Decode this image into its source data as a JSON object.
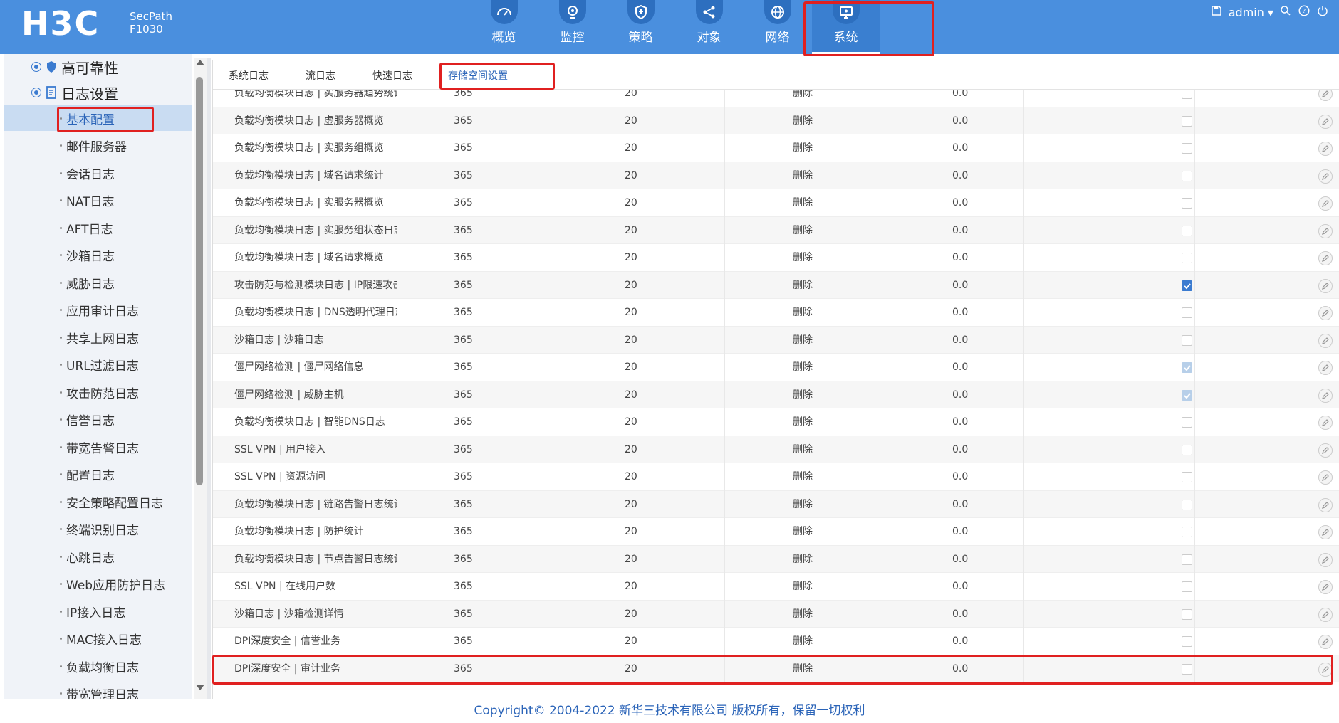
{
  "header": {
    "brand": "H3C",
    "product_line1": "SecPath",
    "product_line2": "F1030",
    "nav": [
      {
        "label": "概览",
        "icon": "dashboard-icon"
      },
      {
        "label": "监控",
        "icon": "monitor-icon"
      },
      {
        "label": "策略",
        "icon": "shield-icon"
      },
      {
        "label": "对象",
        "icon": "share-icon"
      },
      {
        "label": "网络",
        "icon": "globe-icon"
      },
      {
        "label": "系统",
        "icon": "system-icon"
      }
    ],
    "active_nav": "系统",
    "user": "admin"
  },
  "sidebar": {
    "groups": [
      {
        "label": "高可靠性"
      },
      {
        "label": "日志设置"
      }
    ],
    "items": [
      {
        "label": "基本配置"
      },
      {
        "label": "邮件服务器"
      },
      {
        "label": "会话日志"
      },
      {
        "label": "NAT日志"
      },
      {
        "label": "AFT日志"
      },
      {
        "label": "沙箱日志"
      },
      {
        "label": "威胁日志"
      },
      {
        "label": "应用审计日志"
      },
      {
        "label": "共享上网日志"
      },
      {
        "label": "URL过滤日志"
      },
      {
        "label": "攻击防范日志"
      },
      {
        "label": "信誉日志"
      },
      {
        "label": "带宽告警日志"
      },
      {
        "label": "配置日志"
      },
      {
        "label": "安全策略配置日志"
      },
      {
        "label": "终端识别日志"
      },
      {
        "label": "心跳日志"
      },
      {
        "label": "Web应用防护日志"
      },
      {
        "label": "IP接入日志"
      },
      {
        "label": "MAC接入日志"
      },
      {
        "label": "负载均衡日志"
      },
      {
        "label": "带宽管理日志"
      }
    ],
    "active_item": "基本配置"
  },
  "tabs": [
    {
      "label": "系统日志"
    },
    {
      "label": "流日志"
    },
    {
      "label": "快速日志"
    },
    {
      "label": "存储空间设置"
    }
  ],
  "active_tab": "存储空间设置",
  "table": {
    "rows": [
      {
        "name": "负载均衡模块日志 | 实服务器趋势统计",
        "days": "365",
        "percent": "20",
        "action": "删除",
        "used": "0.0",
        "checked": "off"
      },
      {
        "name": "负载均衡模块日志 | 虚服务器概览",
        "days": "365",
        "percent": "20",
        "action": "删除",
        "used": "0.0",
        "checked": "off"
      },
      {
        "name": "负载均衡模块日志 | 实服务组概览",
        "days": "365",
        "percent": "20",
        "action": "删除",
        "used": "0.0",
        "checked": "off"
      },
      {
        "name": "负载均衡模块日志 | 域名请求统计",
        "days": "365",
        "percent": "20",
        "action": "删除",
        "used": "0.0",
        "checked": "off"
      },
      {
        "name": "负载均衡模块日志 | 实服务器概览",
        "days": "365",
        "percent": "20",
        "action": "删除",
        "used": "0.0",
        "checked": "off"
      },
      {
        "name": "负载均衡模块日志 | 实服务组状态日志统...",
        "days": "365",
        "percent": "20",
        "action": "删除",
        "used": "0.0",
        "checked": "off"
      },
      {
        "name": "负载均衡模块日志 | 域名请求概览",
        "days": "365",
        "percent": "20",
        "action": "删除",
        "used": "0.0",
        "checked": "off"
      },
      {
        "name": "攻击防范与检测模块日志 | IP限速攻击告警",
        "days": "365",
        "percent": "20",
        "action": "删除",
        "used": "0.0",
        "checked": "on"
      },
      {
        "name": "负载均衡模块日志 | DNS透明代理日志",
        "days": "365",
        "percent": "20",
        "action": "删除",
        "used": "0.0",
        "checked": "off"
      },
      {
        "name": "沙箱日志 | 沙箱日志",
        "days": "365",
        "percent": "20",
        "action": "删除",
        "used": "0.0",
        "checked": "off"
      },
      {
        "name": "僵尸网络检测 | 僵尸网络信息",
        "days": "365",
        "percent": "20",
        "action": "删除",
        "used": "0.0",
        "checked": "dis"
      },
      {
        "name": "僵尸网络检测 | 威胁主机",
        "days": "365",
        "percent": "20",
        "action": "删除",
        "used": "0.0",
        "checked": "dis"
      },
      {
        "name": "负载均衡模块日志 | 智能DNS日志",
        "days": "365",
        "percent": "20",
        "action": "删除",
        "used": "0.0",
        "checked": "off"
      },
      {
        "name": "SSL VPN | 用户接入",
        "days": "365",
        "percent": "20",
        "action": "删除",
        "used": "0.0",
        "checked": "off"
      },
      {
        "name": "SSL VPN | 资源访问",
        "days": "365",
        "percent": "20",
        "action": "删除",
        "used": "0.0",
        "checked": "off"
      },
      {
        "name": "负载均衡模块日志 | 链路告警日志统计",
        "days": "365",
        "percent": "20",
        "action": "删除",
        "used": "0.0",
        "checked": "off"
      },
      {
        "name": "负载均衡模块日志 | 防护统计",
        "days": "365",
        "percent": "20",
        "action": "删除",
        "used": "0.0",
        "checked": "off"
      },
      {
        "name": "负载均衡模块日志 | 节点告警日志统计",
        "days": "365",
        "percent": "20",
        "action": "删除",
        "used": "0.0",
        "checked": "off"
      },
      {
        "name": "SSL VPN | 在线用户数",
        "days": "365",
        "percent": "20",
        "action": "删除",
        "used": "0.0",
        "checked": "off"
      },
      {
        "name": "沙箱日志 | 沙箱检测详情",
        "days": "365",
        "percent": "20",
        "action": "删除",
        "used": "0.0",
        "checked": "off"
      },
      {
        "name": "DPI深度安全 | 信誉业务",
        "days": "365",
        "percent": "20",
        "action": "删除",
        "used": "0.0",
        "checked": "off"
      },
      {
        "name": "DPI深度安全 | 审计业务",
        "days": "365",
        "percent": "20",
        "action": "删除",
        "used": "0.0",
        "checked": "off"
      }
    ]
  },
  "footer": {
    "copyright": "Copyright© 2004-2022 新华三技术有限公司 版权所有，保留一切权利"
  },
  "colors": {
    "header_bg": "#4a8fde",
    "accent": "#3b7bd0",
    "highlight": "#e02020"
  }
}
